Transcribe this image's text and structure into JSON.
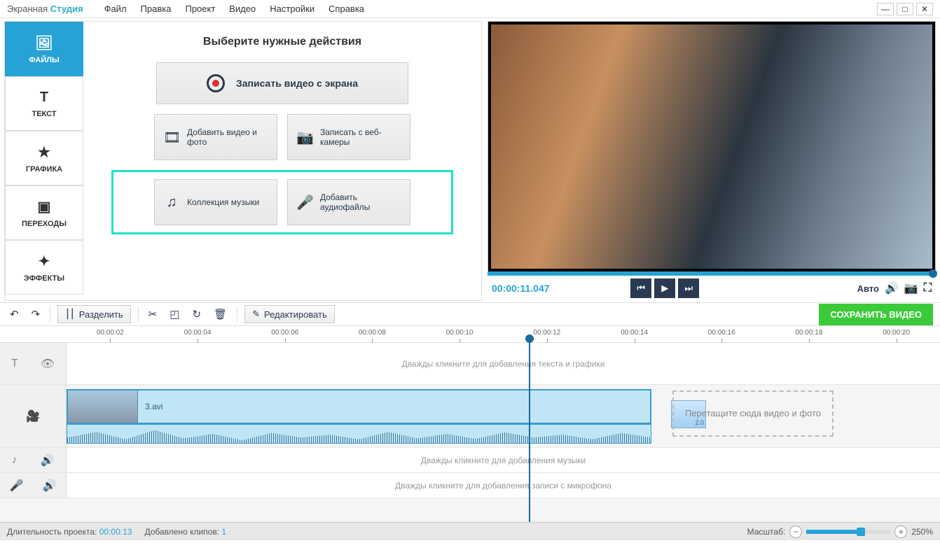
{
  "brand": {
    "a": "Экранная",
    "b": "Студия"
  },
  "menu": [
    "Файл",
    "Правка",
    "Проект",
    "Видео",
    "Настройки",
    "Справка"
  ],
  "sidebar": [
    {
      "label": "ФАЙЛЫ"
    },
    {
      "label": "ТЕКСТ"
    },
    {
      "label": "ГРАФИКА"
    },
    {
      "label": "ПЕРЕХОДЫ"
    },
    {
      "label": "ЭФФЕКТЫ"
    }
  ],
  "panel": {
    "title": "Выберите нужные действия",
    "record": "Записать видео с экрана",
    "add_media": "Добавить видео и фото",
    "webcam": "Записать с веб-камеры",
    "music": "Коллекция музыки",
    "audio": "Добавить аудиофайлы"
  },
  "player": {
    "time": "00:00:11.047",
    "auto": "Авто"
  },
  "toolbar": {
    "split": "Разделить",
    "edit": "Редактировать",
    "save": "СОХРАНИТЬ ВИДЕО"
  },
  "ruler": [
    "00:00:02",
    "00:00:04",
    "00:00:06",
    "00:00:08",
    "00:00:10",
    "00:00:12",
    "00:00:14",
    "00:00:16",
    "00:00:18",
    "00:00:20"
  ],
  "tracks": {
    "text_hint": "Дважды кликните для добавления текста и графики",
    "clip_name": "3.avi",
    "trans_label": "2.0",
    "dropzone": "Перетащите сюда видео и фото",
    "music_hint": "Дважды кликните для добавления музыки",
    "mic_hint": "Дважды кликните для добавления записи с микрофона"
  },
  "status": {
    "duration_label": "Длительность проекта:",
    "duration": "00:00:13",
    "clips_label": "Добавлено клипов:",
    "clips": "1",
    "zoom_label": "Масштаб:",
    "zoom": "250%"
  }
}
